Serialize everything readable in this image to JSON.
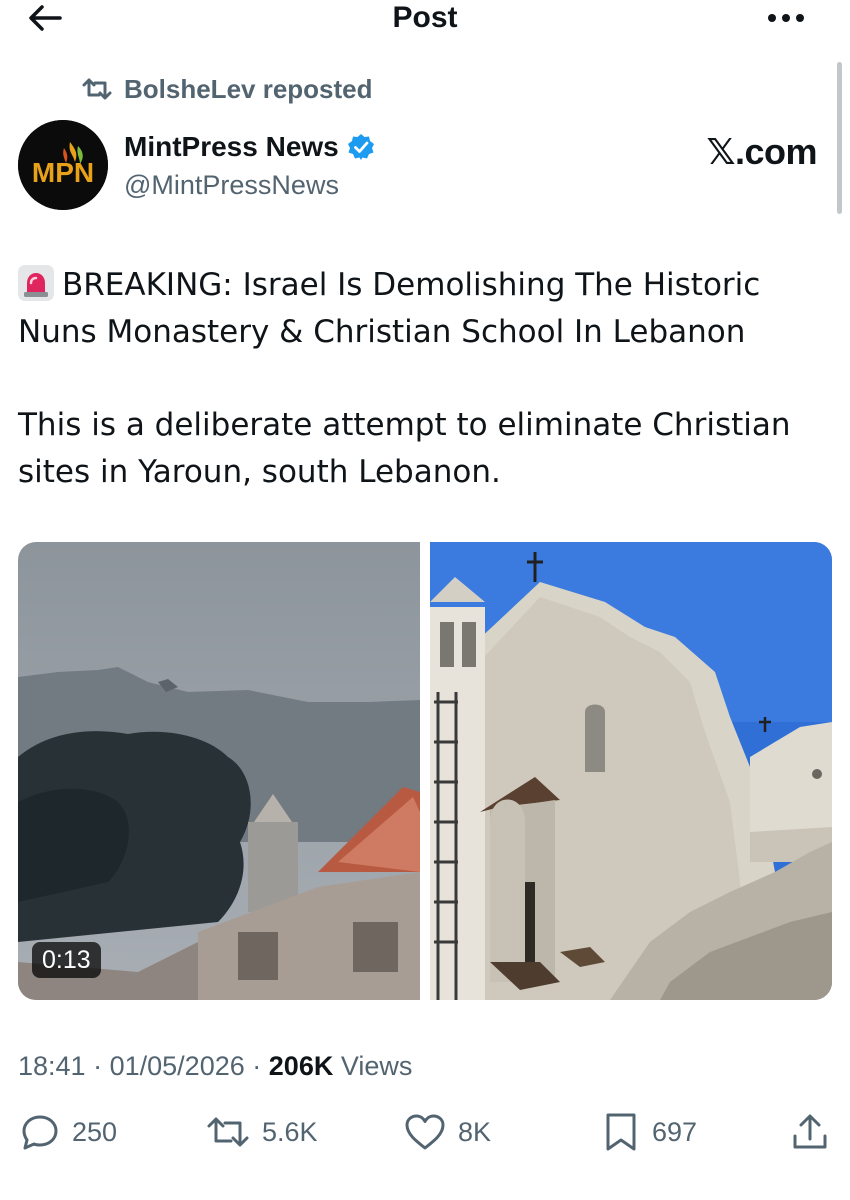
{
  "header": {
    "title": "Post"
  },
  "repost": {
    "label": "BolsheLev reposted"
  },
  "author": {
    "name": "MintPress News",
    "handle": "@MintPressNews",
    "avatar_text": "MPN"
  },
  "watermark": "𝕏.com",
  "post": {
    "paragraph1": "BREAKING: Israel Is Demolishing The Historic Nuns Monastery  & Christian School In Lebanon",
    "paragraph2": "This is a deliberate attempt to eliminate Christian sites in Yaroun, south Lebanon."
  },
  "media": {
    "video_duration": "0:13"
  },
  "meta": {
    "time": "18:41",
    "sep": "·",
    "date": "01/05/2026",
    "views_count": "206K",
    "views_label": "Views"
  },
  "actions": {
    "replies": "250",
    "reposts": "5.6K",
    "likes": "8K",
    "bookmarks": "697"
  },
  "colors": {
    "accent": "#1d9bf0",
    "secondary_text": "#536471",
    "primary_text": "#0f1419"
  },
  "icons": [
    "back-arrow-icon",
    "more-icon",
    "repost-icon",
    "verified-icon",
    "siren-icon",
    "reply-icon",
    "heart-icon",
    "bookmark-icon",
    "share-icon"
  ]
}
